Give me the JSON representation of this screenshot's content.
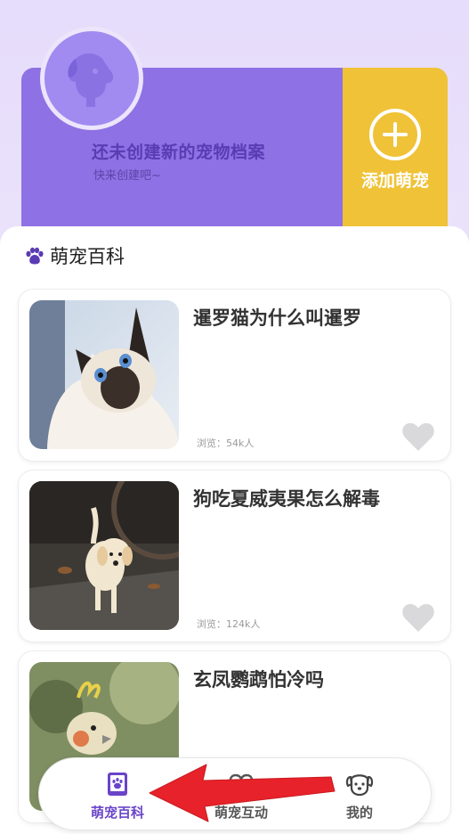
{
  "profile": {
    "title": "还未创建新的宠物档案",
    "subtitle": "快来创建吧~",
    "add_label": "添加萌宠"
  },
  "section": {
    "title": "萌宠百科"
  },
  "articles": [
    {
      "title": "暹罗猫为什么叫暹罗",
      "views": "浏览：54k人"
    },
    {
      "title": "狗吃夏威夷果怎么解毒",
      "views": "浏览：124k人"
    },
    {
      "title": "玄凤鹦鹉怕冷吗",
      "views": ""
    }
  ],
  "nav": {
    "items": [
      {
        "label": "萌宠百科",
        "icon": "encyclopedia-icon",
        "active": true
      },
      {
        "label": "萌宠互动",
        "icon": "interaction-icon",
        "active": false
      },
      {
        "label": "我的",
        "icon": "dog-face-icon",
        "active": false
      }
    ]
  },
  "colors": {
    "accent": "#8e71e4",
    "add_button": "#f0c237",
    "active_nav": "#6a44c9",
    "annotation_arrow": "#e8222a"
  }
}
